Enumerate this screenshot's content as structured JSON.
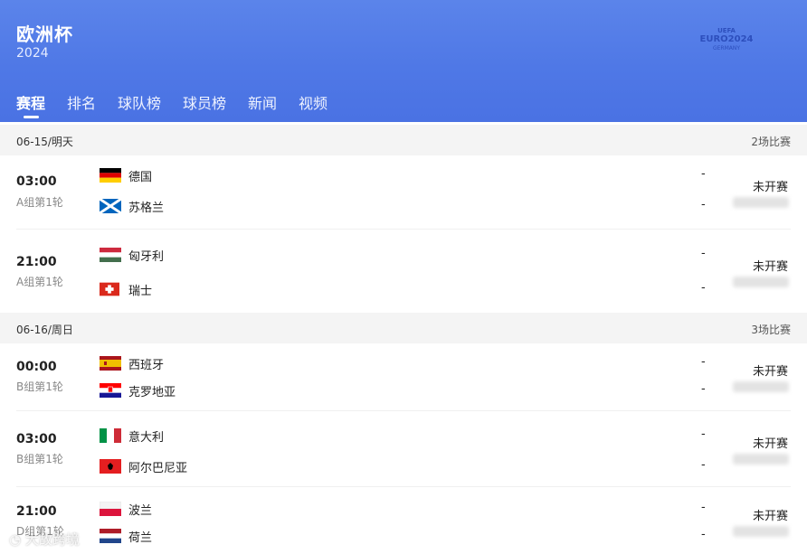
{
  "header": {
    "title": "欧洲杯",
    "year": "2024",
    "logo": {
      "top": "UEFA",
      "main": "EURO2024",
      "sub": "GERMANY"
    }
  },
  "tabs": [
    {
      "label": "赛程",
      "active": true
    },
    {
      "label": "排名"
    },
    {
      "label": "球队榜"
    },
    {
      "label": "球员榜"
    },
    {
      "label": "新闻"
    },
    {
      "label": "视频"
    }
  ],
  "days": [
    {
      "date": "06-15/明天",
      "count": "2场比赛",
      "matches": [
        {
          "time": "03:00",
          "group": "A组第1轮",
          "home": "德国",
          "away": "苏格兰",
          "home_score": "-",
          "away_score": "-",
          "status": "未开赛"
        },
        {
          "time": "21:00",
          "group": "A组第1轮",
          "home": "匈牙利",
          "away": "瑞士",
          "home_score": "-",
          "away_score": "-",
          "status": "未开赛"
        }
      ]
    },
    {
      "date": "06-16/周日",
      "count": "3场比赛",
      "matches": [
        {
          "time": "00:00",
          "group": "B组第1轮",
          "home": "西班牙",
          "away": "克罗地亚",
          "home_score": "-",
          "away_score": "-",
          "status": "未开赛"
        },
        {
          "time": "03:00",
          "group": "B组第1轮",
          "home": "意大利",
          "away": "阿尔巴尼亚",
          "home_score": "-",
          "away_score": "-",
          "status": "未开赛"
        },
        {
          "time": "21:00",
          "group": "D组第1轮",
          "home": "波兰",
          "away": "荷兰",
          "home_score": "-",
          "away_score": "-",
          "status": "未开赛"
        }
      ]
    }
  ],
  "watermark": "大故跨境"
}
